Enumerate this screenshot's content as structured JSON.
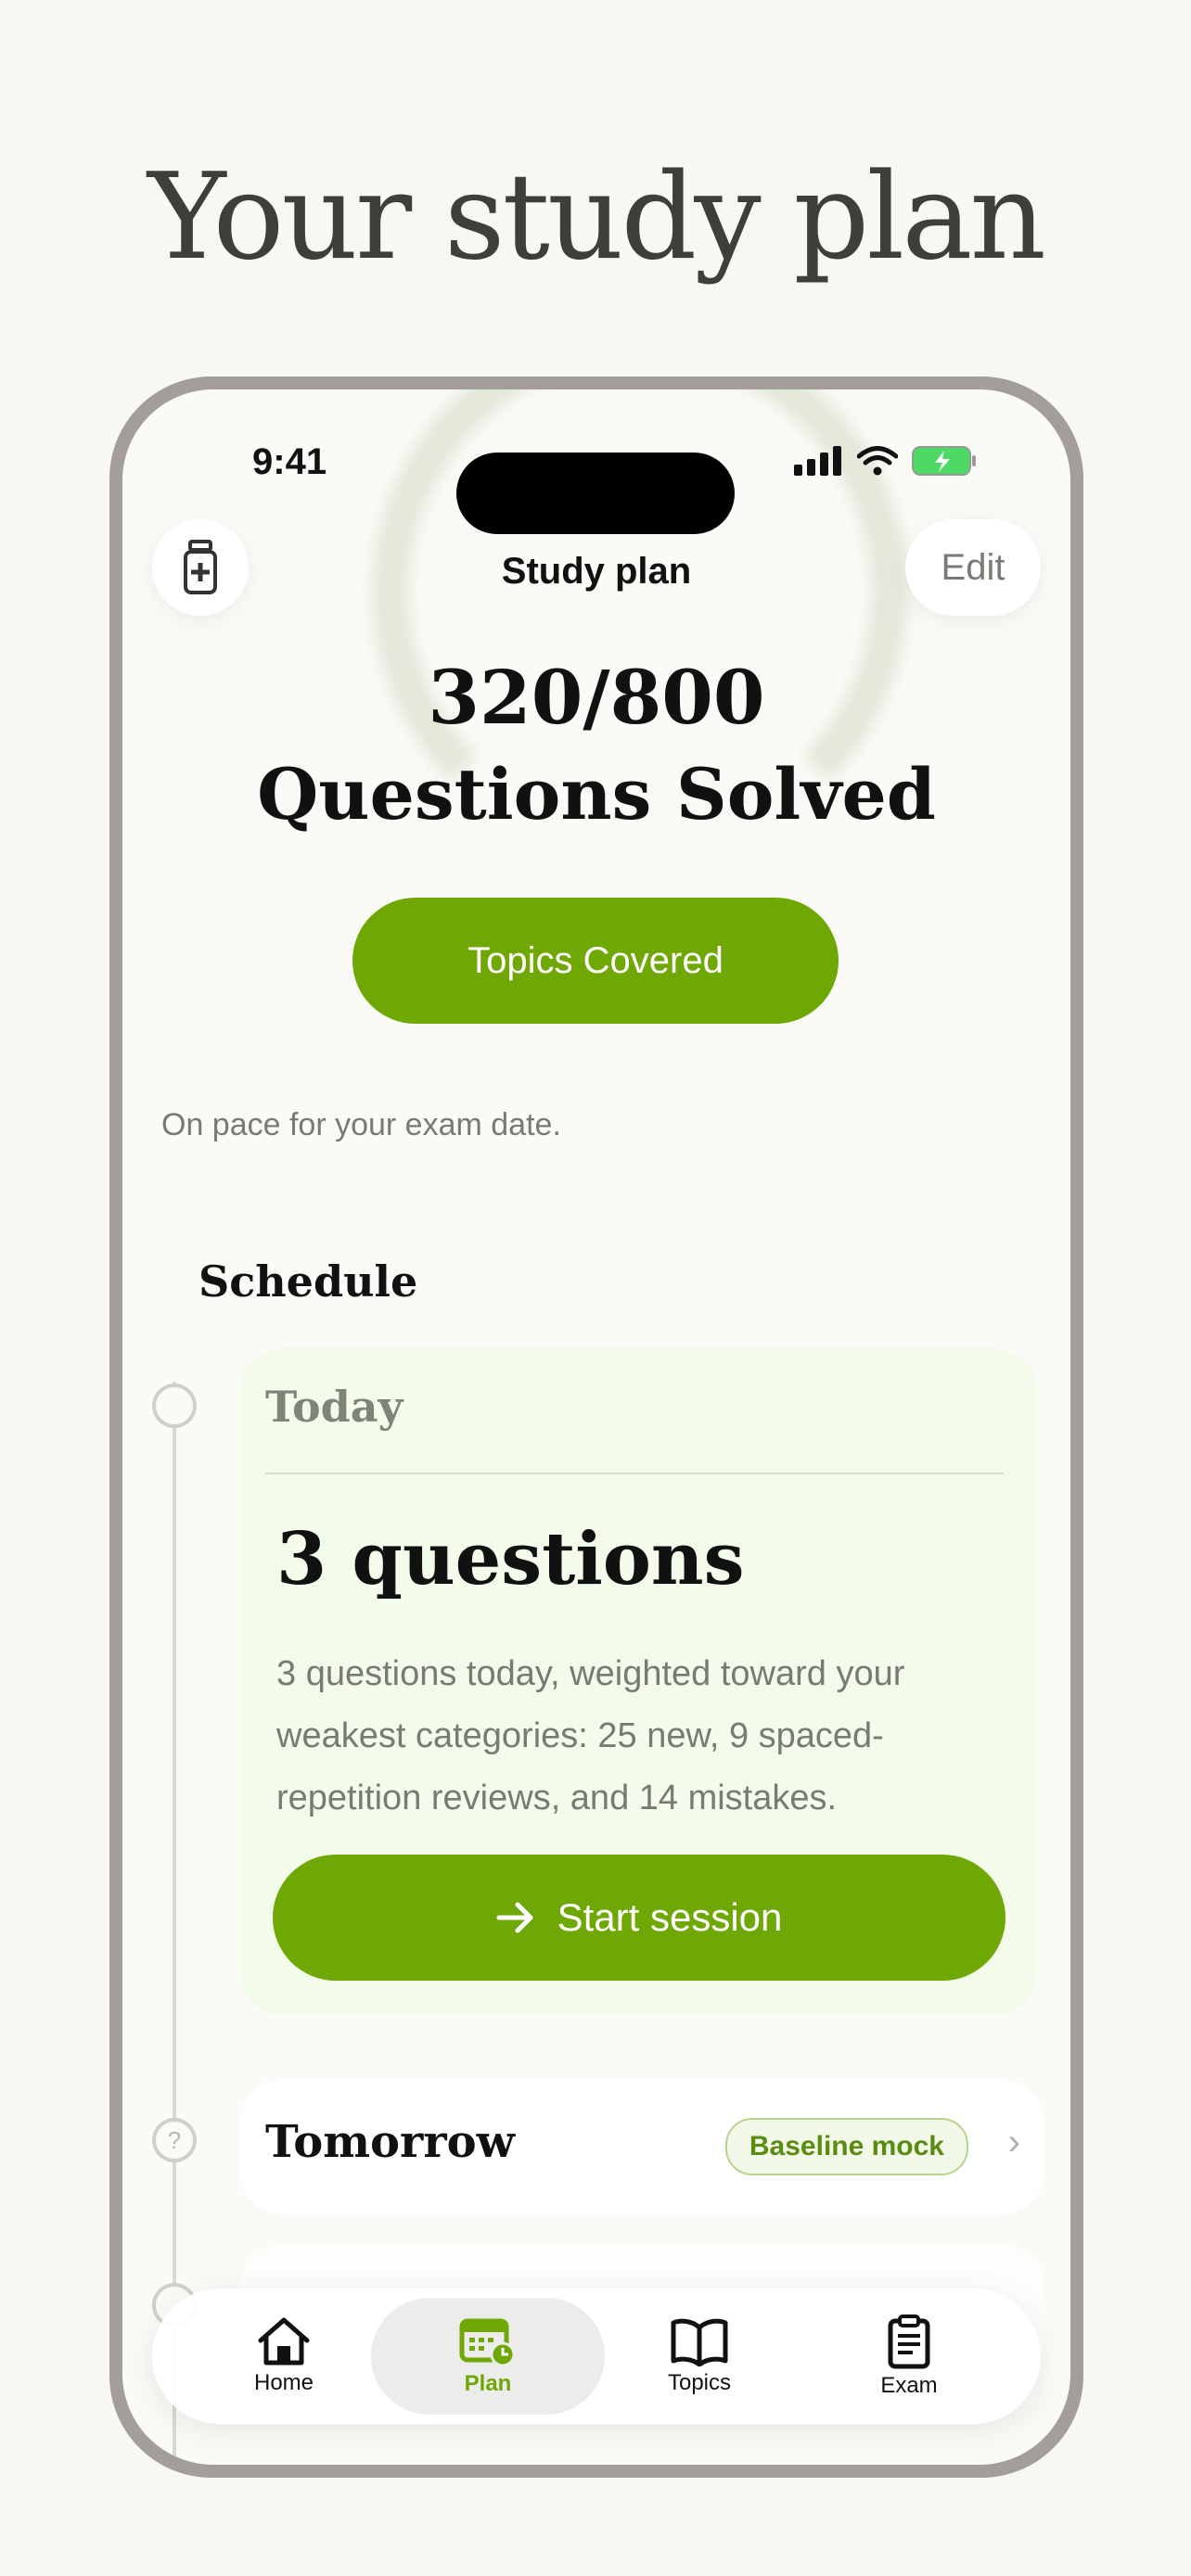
{
  "headline": "Your study plan",
  "status_bar": {
    "time": "9:41"
  },
  "nav": {
    "title": "Study plan",
    "edit_label": "Edit"
  },
  "progress": {
    "count": "320/800",
    "label": "Questions Solved"
  },
  "topics_button": "Topics Covered",
  "pace_text": "On pace for your exam date.",
  "schedule": {
    "title": "Schedule",
    "today": {
      "label": "Today",
      "questions": "3 questions",
      "description": "3 questions today, weighted toward your weakest categories: 25 new, 9 spaced-repetition reviews, and 14 mistakes.",
      "start_label": "Start session"
    },
    "tomorrow": {
      "label": "Tomorrow",
      "badge": "Baseline mock",
      "dot_icon": "?"
    }
  },
  "tabbar": {
    "items": [
      {
        "label": "Home",
        "icon": "home-icon"
      },
      {
        "label": "Plan",
        "icon": "calendar-icon"
      },
      {
        "label": "Topics",
        "icon": "book-icon"
      },
      {
        "label": "Exam",
        "icon": "clipboard-icon"
      }
    ],
    "active": "Plan"
  },
  "colors": {
    "accent": "#6fa704",
    "background": "#f8f8f3",
    "frame": "#a39e9a"
  }
}
